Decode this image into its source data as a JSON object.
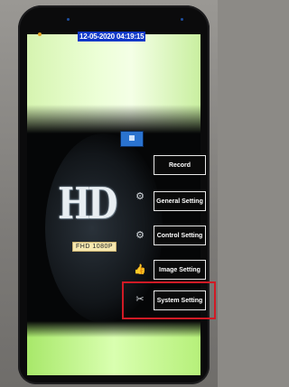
{
  "status_bar": {
    "datetime": "12-05-2020 04:19:15"
  },
  "brand": {
    "logo_text": "HD",
    "resolution_badge": "FHD 1080P"
  },
  "menu": {
    "items": [
      {
        "label": "Record",
        "icon": "camera-icon"
      },
      {
        "label": "General Setting",
        "icon": "gear-icon"
      },
      {
        "label": "Control Setting",
        "icon": "gears-icon"
      },
      {
        "label": "Image Setting",
        "icon": "thumb-icon"
      },
      {
        "label": "System Setting",
        "icon": "tools-icon"
      }
    ]
  },
  "colors": {
    "datetime_bg": "#1038c8",
    "highlight_box": "#d01a25",
    "badge_bg": "#f6e8b0"
  }
}
